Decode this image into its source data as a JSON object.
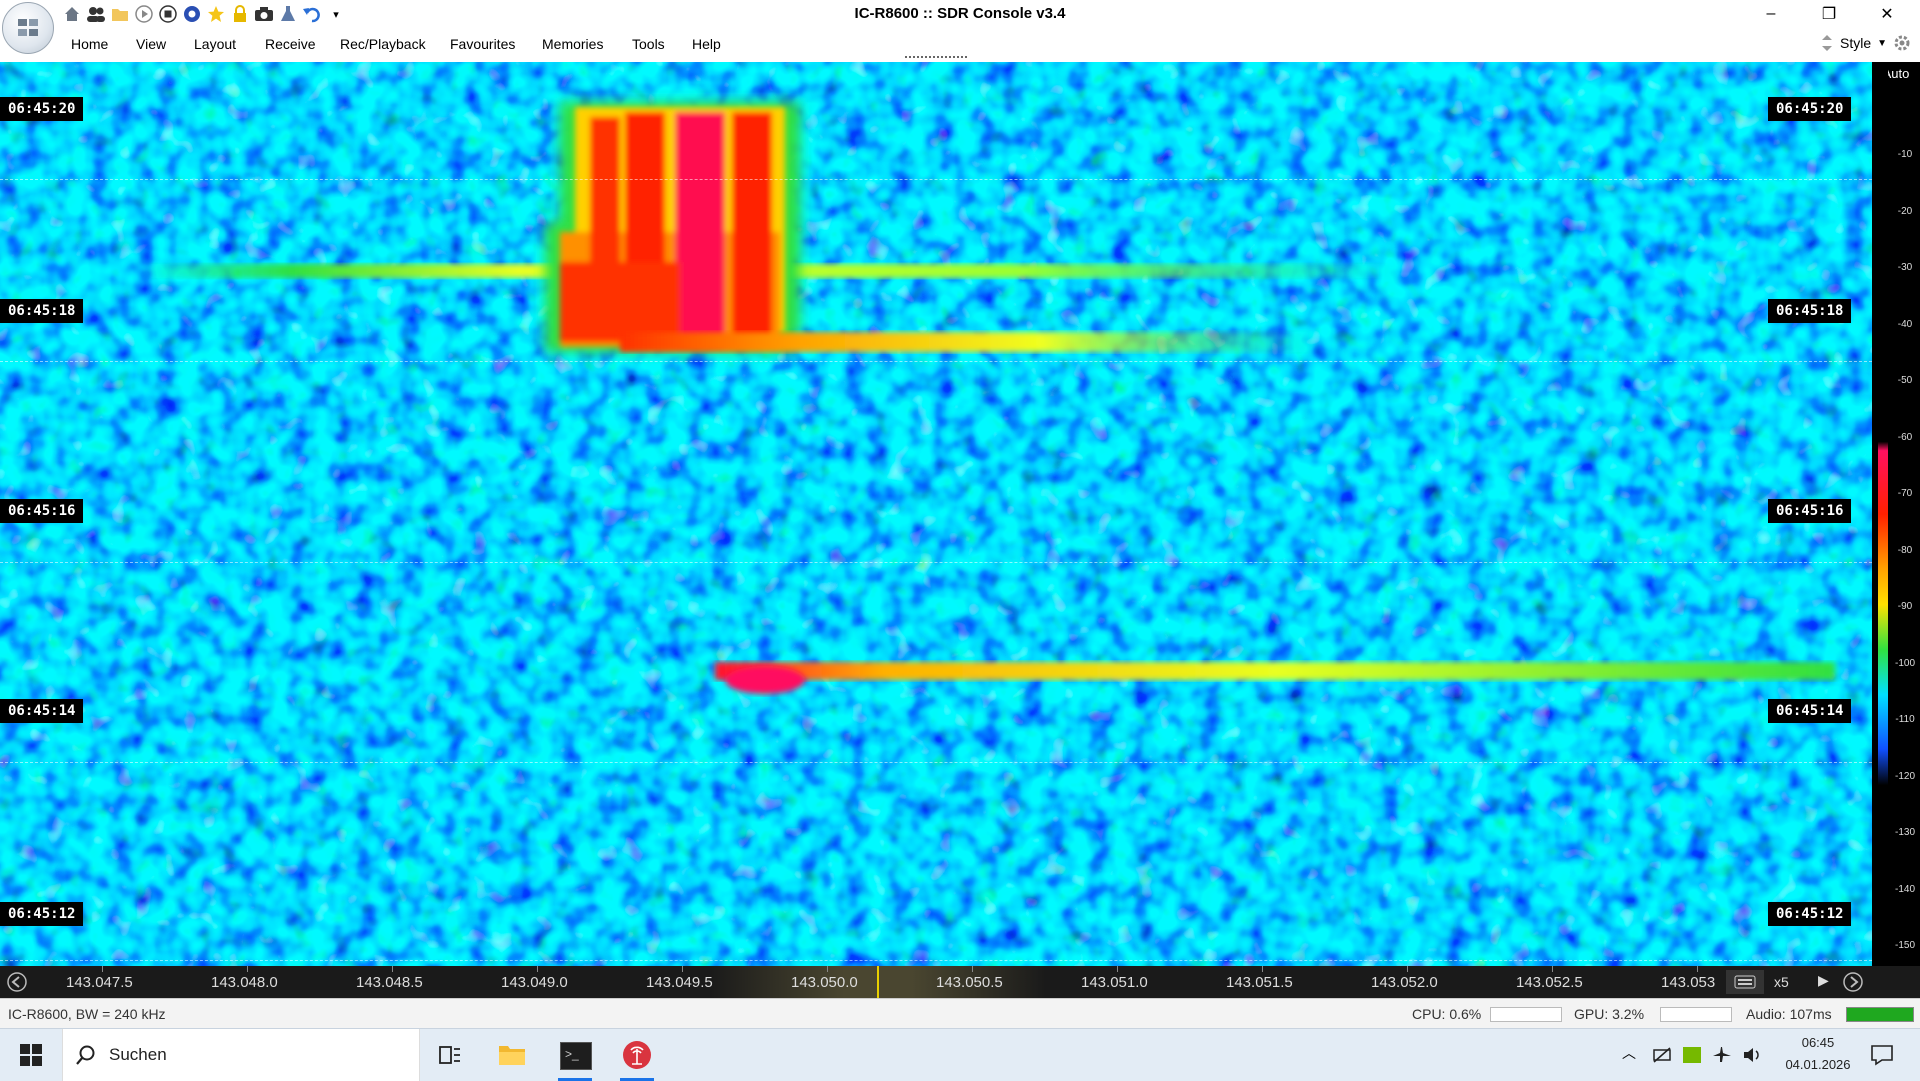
{
  "window": {
    "title": "IC-R8600 :: SDR Console v3.4",
    "minimize": "–",
    "restore": "❐",
    "close": "✕"
  },
  "qat_icons": [
    "home-icon",
    "users-icon",
    "folder-icon",
    "play-icon",
    "stop-icon",
    "record-icon",
    "favourite-icon",
    "lock-icon",
    "camera-icon",
    "flask-icon",
    "undo-icon",
    "dropdown-icon"
  ],
  "menu": {
    "items": [
      "Home",
      "View",
      "Layout",
      "Receive",
      "Rec/Playback",
      "Favourites",
      "Memories",
      "Tools",
      "Help"
    ],
    "style_label": "Style"
  },
  "waterfall": {
    "scale_mode": "Auto",
    "db_scale": [
      "-10",
      "-20",
      "-30",
      "-40",
      "-50",
      "-60",
      "-70",
      "-80",
      "-90",
      "-100",
      "-110",
      "-120",
      "-130",
      "-140",
      "-150"
    ],
    "time_labels": [
      "06:45:20",
      "06:45:18",
      "06:45:16",
      "06:45:14",
      "06:45:12"
    ],
    "colors": {
      "background": "#1f4fe0",
      "noise_hot": "#00e0ff",
      "signal_low": "#2edc3a",
      "signal_mid": "#ffe000",
      "signal_high": "#ff2000",
      "signal_peak": "#ff1070"
    }
  },
  "frequency_axis": {
    "ticks": [
      "143.047.5",
      "143.048.0",
      "143.048.5",
      "143.049.0",
      "143.049.5",
      "143.050.0",
      "143.050.5",
      "143.051.0",
      "143.051.5",
      "143.052.0",
      "143.052.5",
      "143.053"
    ],
    "zoom": "x5"
  },
  "status": {
    "radio": "IC-R8600, BW = 240 kHz",
    "cpu": "CPU: 0.6%",
    "gpu": "GPU: 3.2%",
    "audio": "Audio: 107ms"
  },
  "taskbar": {
    "search_placeholder": "Suchen",
    "time": "06:45",
    "date": "04.01.2026"
  }
}
